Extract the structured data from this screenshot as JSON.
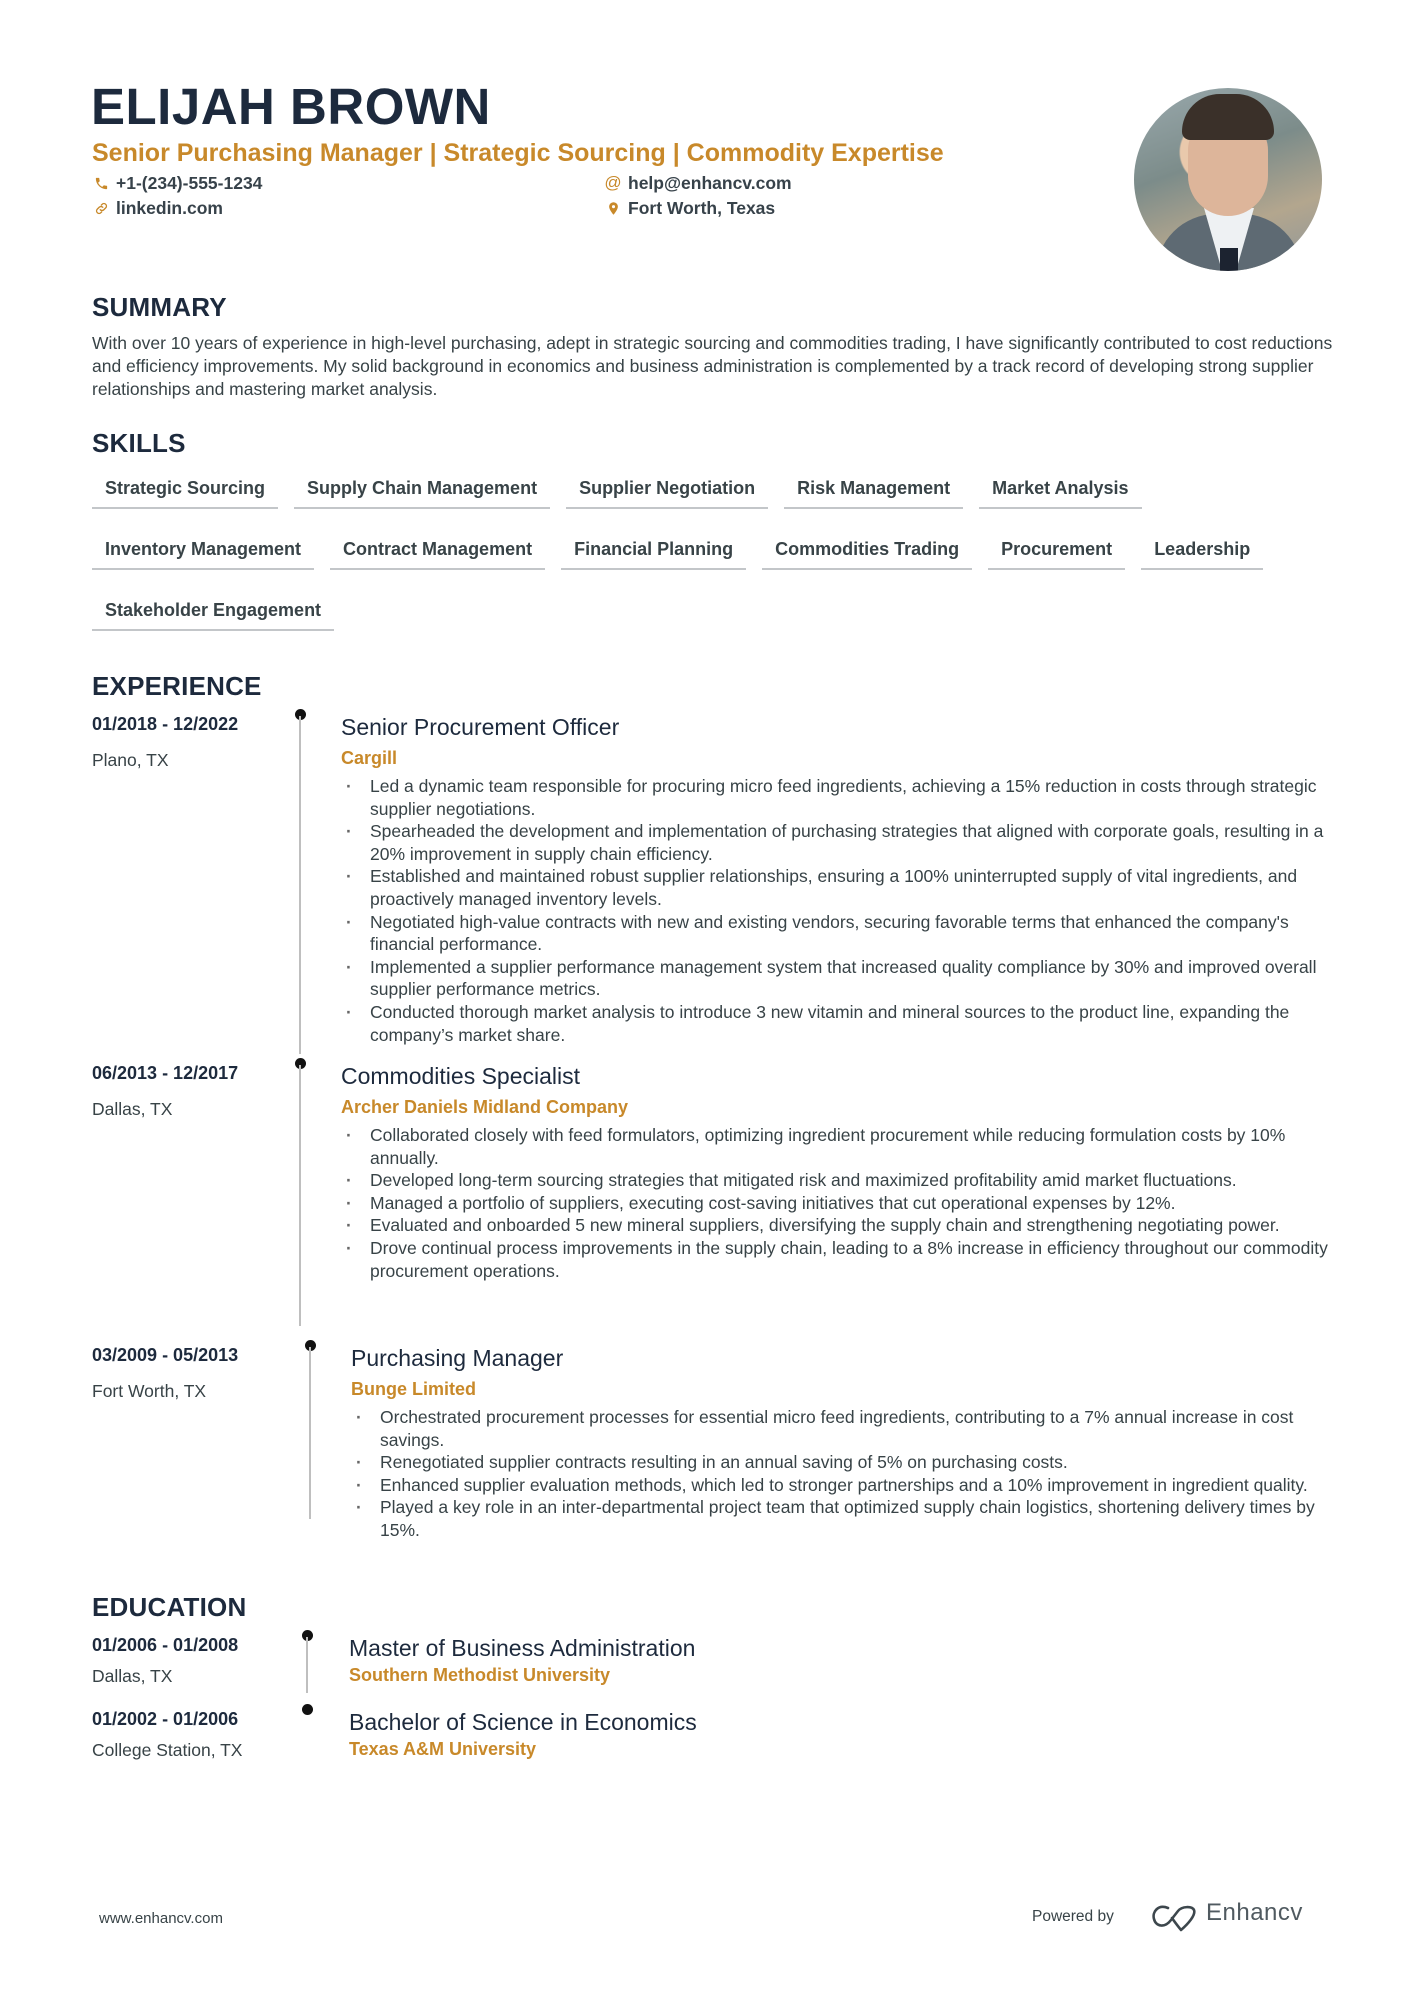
{
  "header": {
    "name": "ELIJAH BROWN",
    "headline": "Senior Purchasing Manager | Strategic Sourcing | Commodity Expertise",
    "contacts": {
      "phone": {
        "icon": "phone-icon",
        "text": "+1-(234)-555-1234"
      },
      "email": {
        "icon": "at-icon",
        "text": "help@enhancv.com"
      },
      "linkedin": {
        "icon": "link-icon",
        "text": "linkedin.com"
      },
      "location": {
        "icon": "location-pin-icon",
        "text": "Fort Worth, Texas"
      }
    },
    "photo_alt": "profile photo"
  },
  "colors": {
    "accent": "#c8892a",
    "heading": "#1d2a3d",
    "body": "#384347"
  },
  "summary": {
    "title": "SUMMARY",
    "text": "With over 10 years of experience in high-level purchasing, adept in strategic sourcing and commodities trading, I have significantly contributed to cost reductions and efficiency improvements. My solid background in economics and business administration is complemented by a track record of developing strong supplier relationships and mastering market analysis."
  },
  "skills": {
    "title": "SKILLS",
    "items": [
      "Strategic Sourcing",
      "Supply Chain Management",
      "Supplier Negotiation",
      "Risk Management",
      "Market Analysis",
      "Inventory Management",
      "Contract Management",
      "Financial Planning",
      "Commodities Trading",
      "Procurement",
      "Leadership",
      "Stakeholder Engagement"
    ]
  },
  "experience": {
    "title": "EXPERIENCE",
    "jobs": [
      {
        "dates": "01/2018 - 12/2022",
        "location": "Plano, TX",
        "role": "Senior Procurement Officer",
        "company": "Cargill",
        "bullets": [
          "Led a dynamic team responsible for procuring micro feed ingredients, achieving a 15% reduction in costs through strategic supplier negotiations.",
          "Spearheaded the development and implementation of purchasing strategies that aligned with corporate goals, resulting in a 20% improvement in supply chain efficiency.",
          "Established and maintained robust supplier relationships, ensuring a 100% uninterrupted supply of vital ingredients, and proactively managed inventory levels.",
          "Negotiated high-value contracts with new and existing vendors, securing favorable terms that enhanced the company's financial performance.",
          "Implemented a supplier performance management system that increased quality compliance by 30% and improved overall supplier performance metrics.",
          "Conducted thorough market analysis to introduce 3 new vitamin and mineral sources to the product line, expanding the company’s market share."
        ]
      },
      {
        "dates": "06/2013 - 12/2017",
        "location": "Dallas, TX",
        "role": "Commodities Specialist",
        "company": "Archer Daniels Midland Company",
        "bullets": [
          "Collaborated closely with feed formulators, optimizing ingredient procurement while reducing formulation costs by 10% annually.",
          "Developed long-term sourcing strategies that mitigated risk and maximized profitability amid market fluctuations.",
          "Managed a portfolio of suppliers, executing cost-saving initiatives that cut operational expenses by 12%.",
          "Evaluated and onboarded 5 new mineral suppliers, diversifying the supply chain and strengthening negotiating power.",
          "Drove continual process improvements in the supply chain, leading to a 8% increase in efficiency throughout our commodity procurement operations."
        ]
      },
      {
        "dates": "03/2009 - 05/2013",
        "location": "Fort Worth, TX",
        "role": "Purchasing Manager",
        "company": "Bunge Limited",
        "bullets": [
          "Orchestrated procurement processes for essential micro feed ingredients, contributing to a 7% annual increase in cost savings.",
          "Renegotiated supplier contracts resulting in an annual saving of 5% on purchasing costs.",
          "Enhanced supplier evaluation methods, which led to stronger partnerships and a 10% improvement in ingredient quality.",
          "Played a key role in an inter-departmental project team that optimized supply chain logistics, shortening delivery times by 15%."
        ]
      }
    ]
  },
  "education": {
    "title": "EDUCATION",
    "items": [
      {
        "dates": "01/2006 - 01/2008",
        "location": "Dallas, TX",
        "degree": "Master of Business Administration",
        "school": "Southern Methodist University"
      },
      {
        "dates": "01/2002 - 01/2006",
        "location": "College Station, TX",
        "degree": "Bachelor of Science in Economics",
        "school": "Texas A&M University"
      }
    ]
  },
  "footer": {
    "url": "www.enhancv.com",
    "powered_by": "Powered by",
    "brand": "Enhancv",
    "logo_icon": "enhancv-logo-icon"
  }
}
